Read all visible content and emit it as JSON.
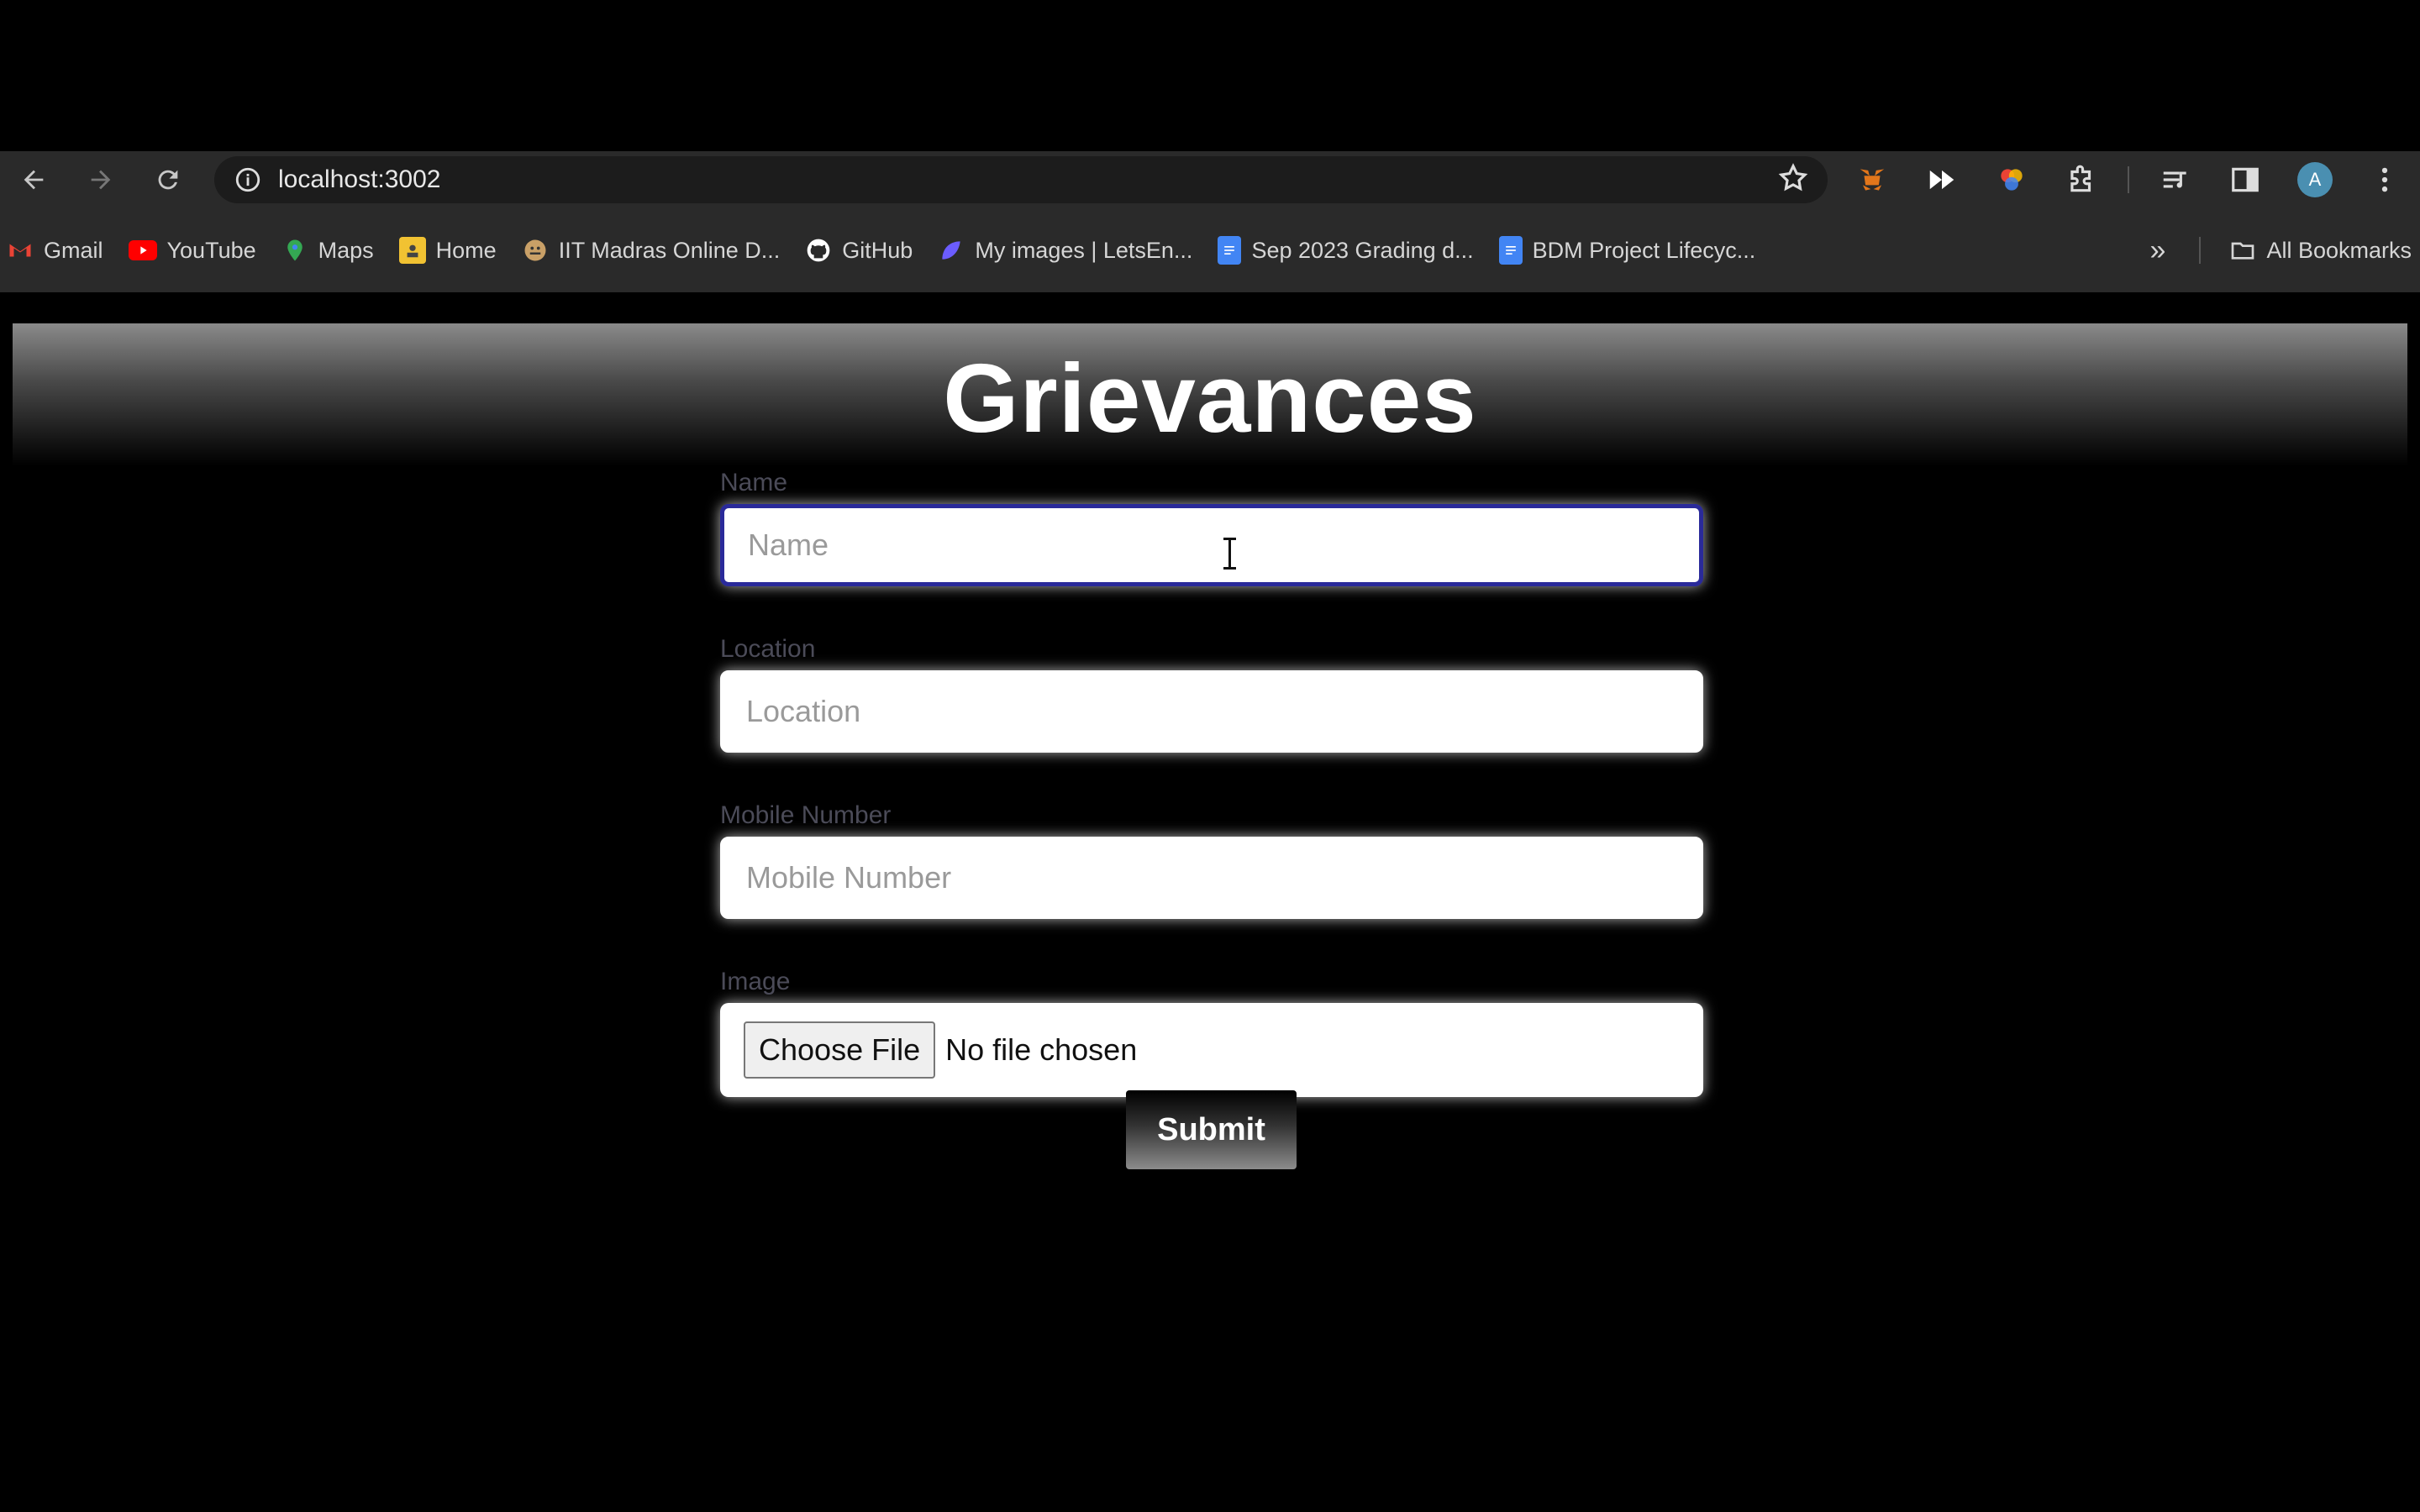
{
  "browser": {
    "url": "localhost:3002",
    "bookmarks": [
      {
        "label": "Gmail",
        "icon": "gmail-icon",
        "color": "#ea4335"
      },
      {
        "label": "YouTube",
        "icon": "youtube-icon",
        "color": "#ff0000"
      },
      {
        "label": "Maps",
        "icon": "maps-icon",
        "color": "#34a853"
      },
      {
        "label": "Home",
        "icon": "home-icon",
        "color": "#f1c232"
      },
      {
        "label": "IIT Madras Online D...",
        "icon": "iitm-icon",
        "color": "#c9a067"
      },
      {
        "label": "GitHub",
        "icon": "github-icon",
        "color": "#ffffff"
      },
      {
        "label": "My images | LetsEn...",
        "icon": "letsenhance-icon",
        "color": "#6b5cff"
      },
      {
        "label": "Sep 2023 Grading d...",
        "icon": "docs-icon",
        "color": "#4285f4"
      },
      {
        "label": "BDM Project Lifecyc...",
        "icon": "docs-icon",
        "color": "#4285f4"
      }
    ],
    "all_bookmarks_label": "All Bookmarks",
    "avatar_letter": "A"
  },
  "page": {
    "title": "Grievances",
    "fields": {
      "name": {
        "label": "Name",
        "placeholder": "Name"
      },
      "location": {
        "label": "Location",
        "placeholder": "Location"
      },
      "mobile": {
        "label": "Mobile Number",
        "placeholder": "Mobile Number"
      },
      "image": {
        "label": "Image",
        "button": "Choose File",
        "status": "No file chosen"
      }
    },
    "submit_label": "Submit"
  }
}
